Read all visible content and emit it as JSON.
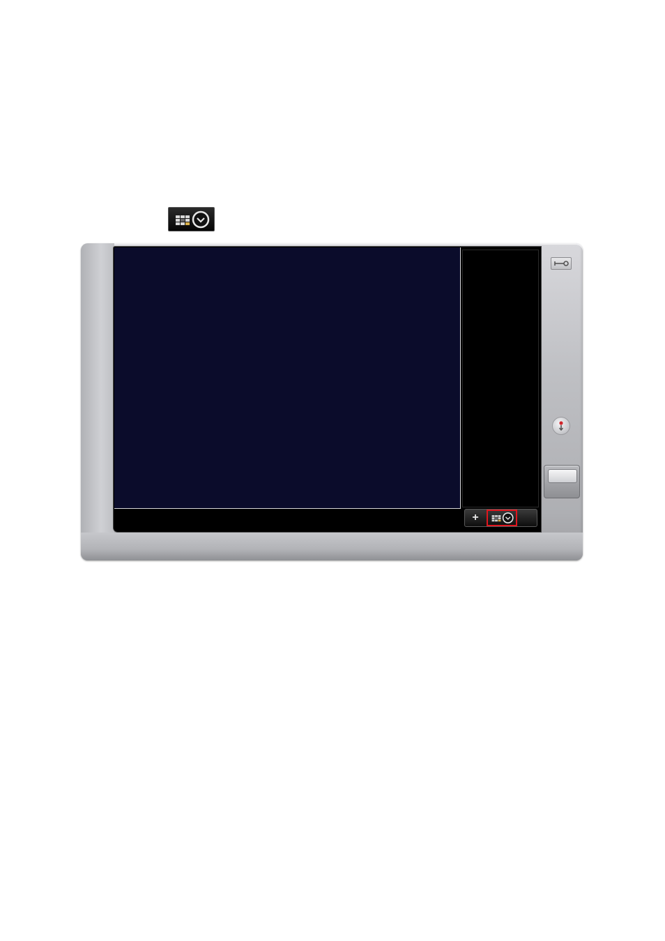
{
  "top_icon": {
    "icon": "schedule-grid-clock-icon"
  },
  "device": {
    "screen": {
      "video_area": {
        "color": "#0b0c2b"
      },
      "side_panel": {
        "toolbar": {
          "add_label": "+",
          "add_icon": "plus-icon",
          "schedule_icon": "schedule-grid-clock-icon",
          "highlight_color": "#e0161e"
        }
      }
    },
    "controls": {
      "settings_icon": "wrench-icon",
      "record_icon": "record-dot-icon",
      "main_button_icon": "rectangular-key-icon"
    }
  }
}
